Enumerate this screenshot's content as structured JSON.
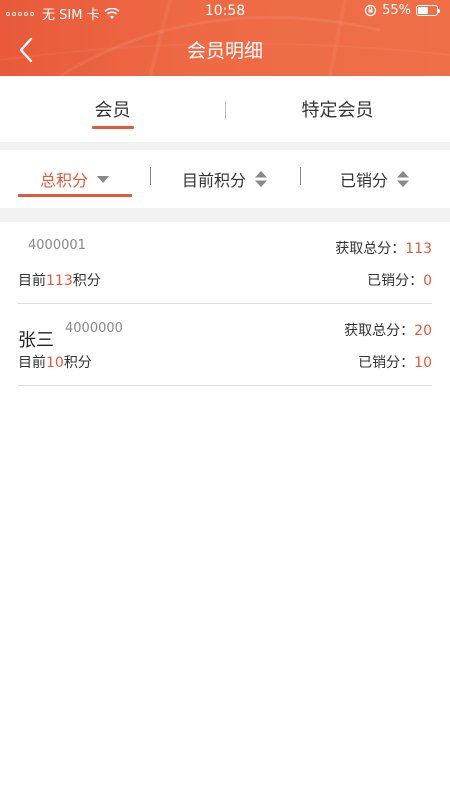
{
  "status_bar": {
    "carrier": "无 SIM 卡",
    "time": "10:58",
    "battery": "55%",
    "battery_level": 0.55
  },
  "nav": {
    "title": "会员明细"
  },
  "tabs": [
    {
      "label": "会员",
      "active": true
    },
    {
      "label": "特定会员",
      "active": false
    }
  ],
  "sort": [
    {
      "label": "总积分",
      "active": true
    },
    {
      "label": "目前积分",
      "active": false
    },
    {
      "label": "已销分",
      "active": false
    }
  ],
  "members": [
    {
      "name": "",
      "id": "4000001",
      "earned_label": "获取总分：",
      "earned": "113",
      "current_prefix": "目前",
      "current": "113",
      "current_suffix": "积分",
      "redeemed_label": "已销分：",
      "redeemed": "0"
    },
    {
      "name": "张三",
      "id": "4000000",
      "earned_label": "获取总分：",
      "earned": "20",
      "current_prefix": "目前",
      "current": "10",
      "current_suffix": "积分",
      "redeemed_label": "已销分：",
      "redeemed": "10"
    }
  ],
  "colors": {
    "accent": "#e05a3c",
    "header": "#ee6a45"
  }
}
